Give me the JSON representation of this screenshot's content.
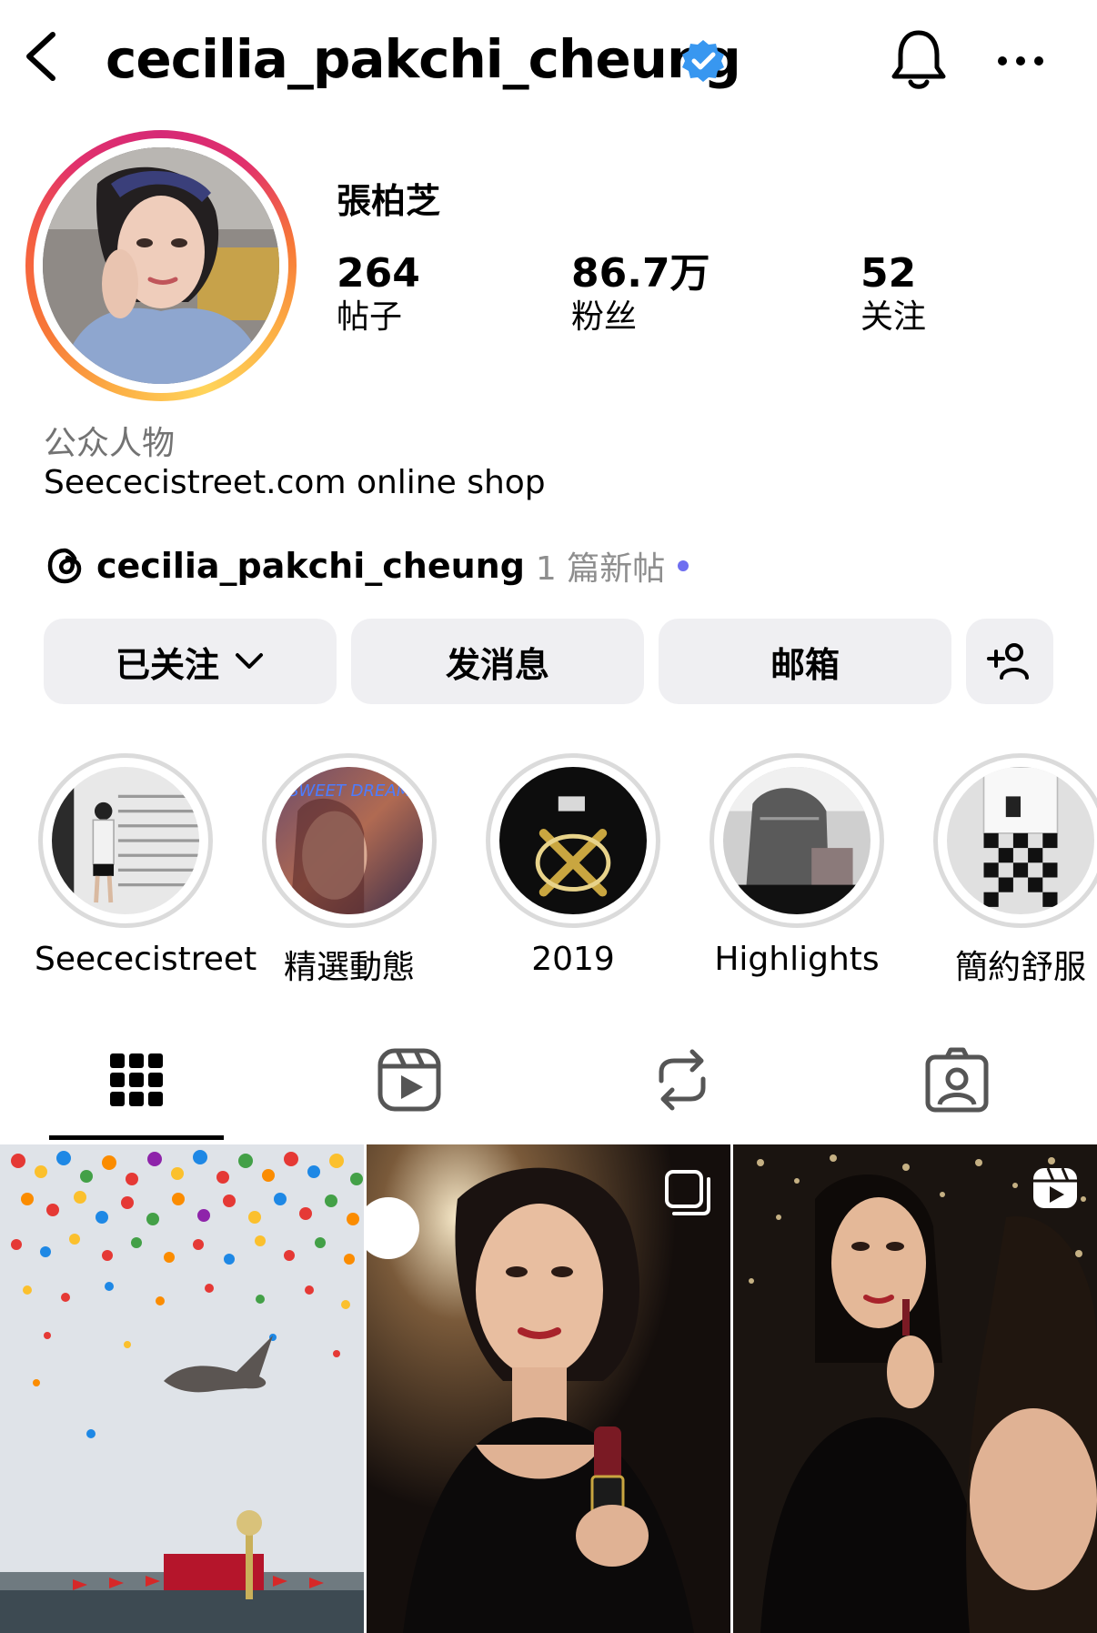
{
  "header": {
    "username": "cecilia_pakchi_cheung",
    "back_icon": "chevron-left-icon",
    "verified_icon": "verified-badge-icon",
    "bell_icon": "bell-icon",
    "more_icon": "more-horizontal-icon",
    "verified_color": "#3897f0"
  },
  "profile": {
    "full_name": "張柏芝",
    "stats": [
      {
        "value": "264",
        "label": "帖子"
      },
      {
        "value": "86.7万",
        "label": "粉丝"
      },
      {
        "value": "52",
        "label": "关注"
      }
    ],
    "category": "公众人物",
    "bio": "Seececistreet.com online shop"
  },
  "threads": {
    "handle": "cecilia_pakchi_cheung",
    "new_posts": "1 篇新帖",
    "dot_color": "#6e6ef0"
  },
  "actions": {
    "following": "已关注",
    "message": "发消息",
    "email": "邮箱",
    "add_person_icon": "add-person-icon"
  },
  "highlights": [
    {
      "label": "Seececistreet"
    },
    {
      "label": "精選動態",
      "overlay_text": "SWEET DREAM"
    },
    {
      "label": "2019"
    },
    {
      "label": "Highlights"
    },
    {
      "label": "簡約舒服"
    }
  ],
  "tabs": [
    {
      "icon": "grid-icon",
      "active": true
    },
    {
      "icon": "reels-icon",
      "active": false
    },
    {
      "icon": "repost-icon",
      "active": false
    },
    {
      "icon": "tagged-icon",
      "active": false
    }
  ],
  "posts": [
    {
      "type": "image"
    },
    {
      "type": "carousel",
      "icon": "carousel-icon"
    },
    {
      "type": "reel",
      "icon": "reel-icon"
    }
  ]
}
